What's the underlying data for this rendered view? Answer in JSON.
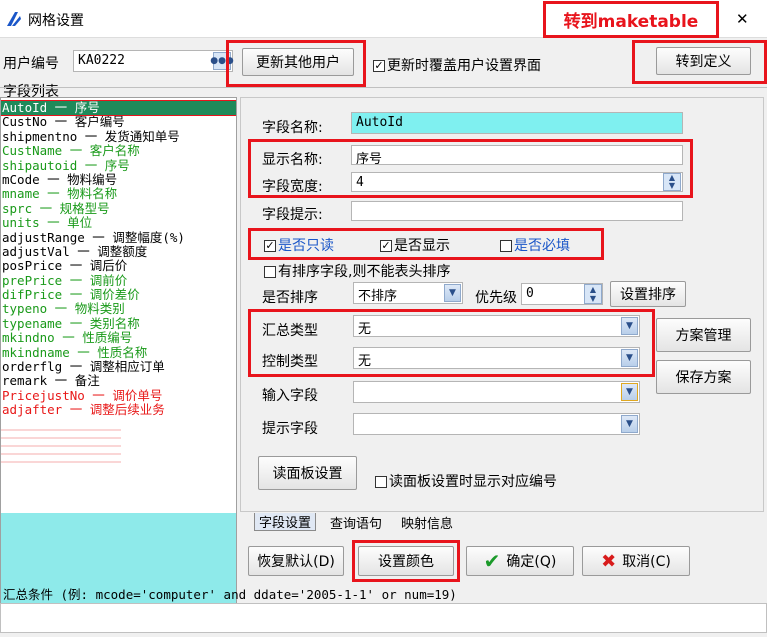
{
  "window": {
    "title": "网格设置",
    "close_symbol": "✕"
  },
  "annotation_top": "转到maketable",
  "header": {
    "user_label": "用户编号",
    "user_value": "KA0222",
    "update_others_button": "更新其他用户",
    "overwrite_checkbox": "更新时覆盖用户设置界面",
    "goto_define_button": "转到定义"
  },
  "field_list": {
    "title": "字段列表",
    "items": [
      {
        "text": "AutoId 一 序号",
        "color": "#ffffff",
        "selected": true
      },
      {
        "text": "CustNo 一 客户编号",
        "color": "#000000"
      },
      {
        "text": "shipmentno 一 发货通知单号",
        "color": "#000000"
      },
      {
        "text": "CustName 一 客户名称",
        "color": "#1a9a1a"
      },
      {
        "text": "shipautoid 一 序号",
        "color": "#1a9a1a"
      },
      {
        "text": "mCode 一 物料编号",
        "color": "#000000"
      },
      {
        "text": "mname 一 物料名称",
        "color": "#1a9a1a"
      },
      {
        "text": "sprc 一 规格型号",
        "color": "#1a9a1a"
      },
      {
        "text": "units 一 单位",
        "color": "#1a9a1a"
      },
      {
        "text": "adjustRange 一 调整幅度(%)",
        "color": "#000000"
      },
      {
        "text": "adjustVal 一 调整额度",
        "color": "#000000"
      },
      {
        "text": "posPrice 一 调后价",
        "color": "#000000"
      },
      {
        "text": "prePrice 一 调前价",
        "color": "#1a9a1a"
      },
      {
        "text": "difPrice 一 调价差价",
        "color": "#1a9a1a"
      },
      {
        "text": "typeno 一 物料类别",
        "color": "#1a9a1a"
      },
      {
        "text": "typename 一 类别名称",
        "color": "#1a9a1a"
      },
      {
        "text": "mkindno 一 性质编号",
        "color": "#1a9a1a"
      },
      {
        "text": "mkindname 一 性质名称",
        "color": "#1a9a1a"
      },
      {
        "text": "orderflg 一 调整相应订单",
        "color": "#000000"
      },
      {
        "text": "remark 一 备注",
        "color": "#000000"
      },
      {
        "text": "PricejustNo 一 调价单号",
        "color": "#e81818"
      },
      {
        "text": "adjafter 一 调整后续业务",
        "color": "#e81818"
      }
    ]
  },
  "field_settings": {
    "field_name_label": "字段名称:",
    "field_name_value": "AutoId",
    "display_name_label": "显示名称:",
    "display_name_value": "序号",
    "width_label": "字段宽度:",
    "width_value": "4",
    "hint_label": "字段提示:",
    "hint_value": "",
    "readonly_label": "是否只读",
    "show_label": "是否显示",
    "required_label": "是否必填",
    "sort_field_note": "有排序字段,则不能表头排序",
    "sort_label": "是否排序",
    "sort_value": "不排序",
    "priority_label": "优先级",
    "priority_value": "0",
    "set_sort_button": "设置排序",
    "summary_type_label": "汇总类型",
    "summary_type_value": "无",
    "control_type_label": "控制类型",
    "control_type_value": "无",
    "input_field_label": "输入字段",
    "hint_field_label": "提示字段",
    "scheme_manage_button": "方案管理",
    "save_scheme_button": "保存方案",
    "read_panel_button": "读面板设置",
    "read_panel_checkbox": "读面板设置时显示对应编号"
  },
  "tabs": [
    "字段设置",
    "查询语句",
    "映射信息"
  ],
  "footer": {
    "restore_button": "恢复默认(D)",
    "set_color_button": "设置颜色",
    "ok_button": "确定(Q)",
    "cancel_button": "取消(C)",
    "summary_condition": "汇总条件 (例: mcode='computer' and ddate='2005-1-1' or num=19)"
  },
  "colors": {
    "highlight_cyan": "#7ff0f0",
    "annotation_red": "#e8141c",
    "accent_blue": "#1a56c8"
  }
}
